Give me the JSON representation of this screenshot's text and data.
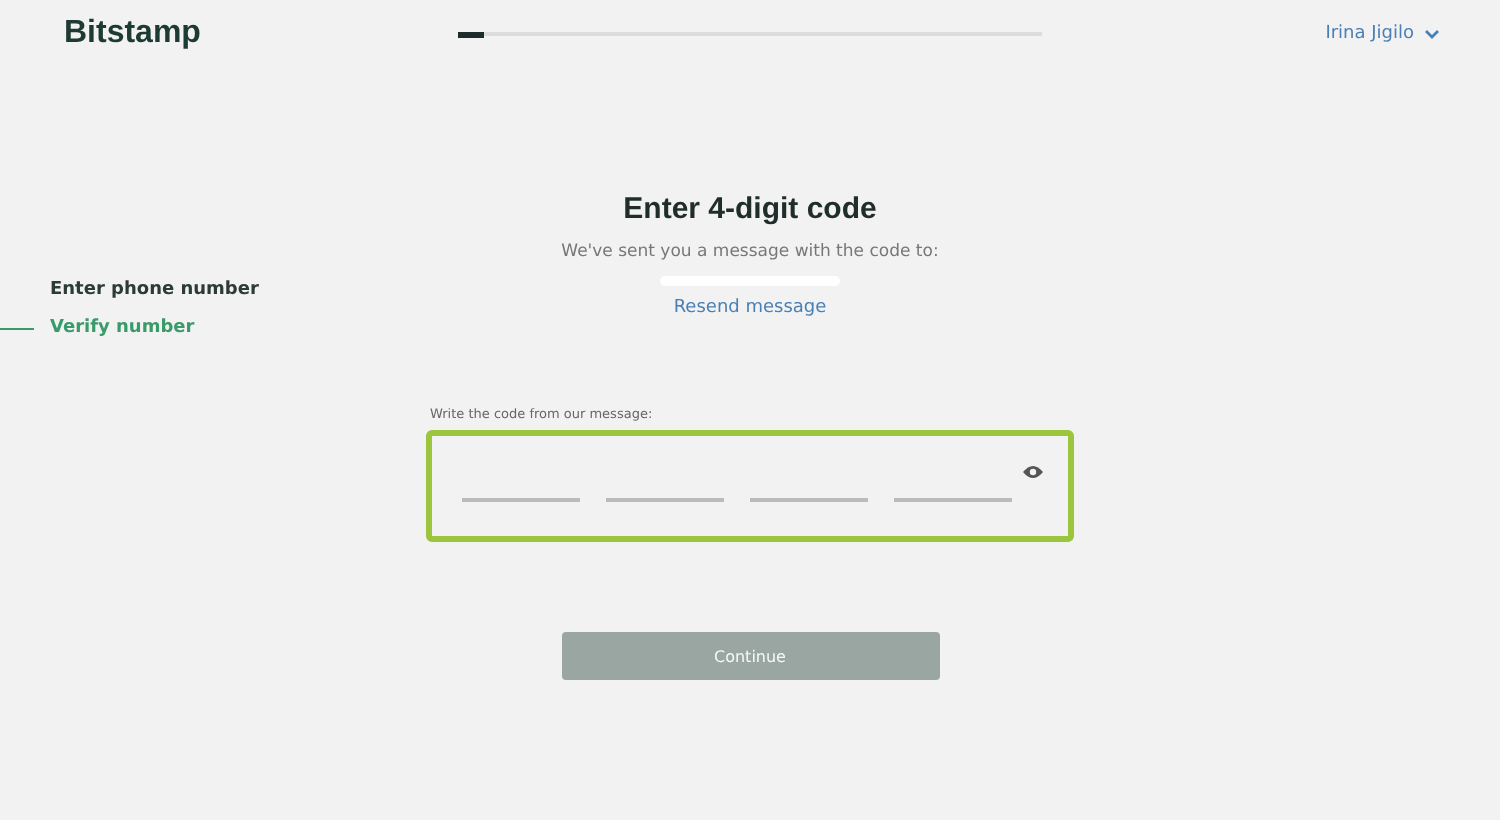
{
  "header": {
    "logo": "Bitstamp",
    "progress": {
      "level": 0.045
    },
    "user_menu": {
      "label": "Irina Jigilo"
    }
  },
  "steps": [
    {
      "label": "Enter phone number",
      "selected": false
    },
    {
      "label": "Verify number",
      "selected": true
    }
  ],
  "title": "Enter 4-digit code",
  "subtitle": "We've sent you a message with the code to:",
  "resend_link": "Resend message",
  "code_field": {
    "label": "Write the code from our message:",
    "focused": true
  },
  "continue_button": {
    "label": "Continue",
    "disabled": true
  }
}
